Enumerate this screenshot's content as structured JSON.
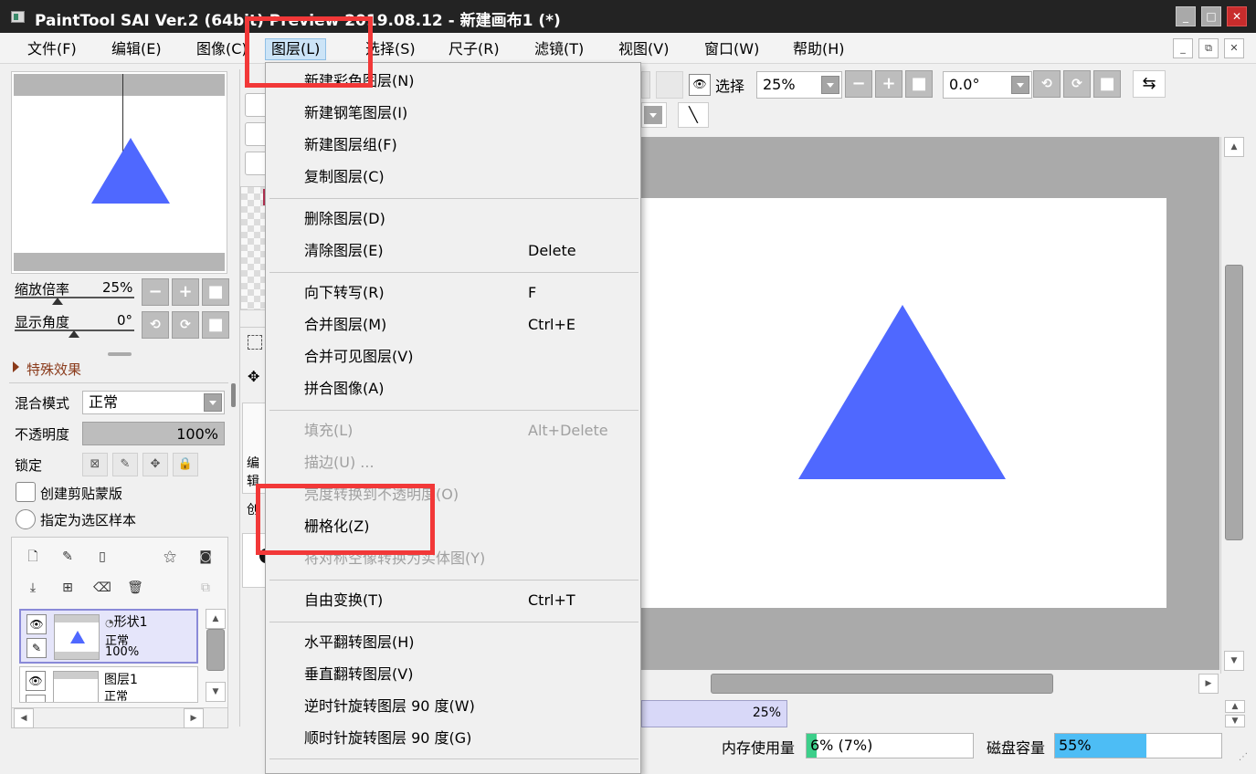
{
  "window": {
    "title": "PaintTool SAI Ver.2 (64bit) Preview 2019.08.12 - 新建画布1 (*)",
    "minimize": "_",
    "maximize": "□",
    "close": "✕"
  },
  "menubar": {
    "items": [
      {
        "label": "文件(F)"
      },
      {
        "label": "编辑(E)"
      },
      {
        "label": "图像(C)"
      },
      {
        "label": "图层(L)"
      },
      {
        "label": "选择(S)"
      },
      {
        "label": "尺子(R)"
      },
      {
        "label": "滤镜(T)"
      },
      {
        "label": "视图(V)"
      },
      {
        "label": "窗口(W)"
      },
      {
        "label": "帮助(H)"
      }
    ]
  },
  "left_panel": {
    "zoom_label": "缩放倍率",
    "zoom_value": "25%",
    "angle_label": "显示角度",
    "angle_value": "0°",
    "effects_label": "特殊效果",
    "blend_label": "混合模式",
    "blend_value": "正常",
    "opacity_label": "不透明度",
    "opacity_value": "100%",
    "lock_label": "锁定",
    "clip_label": "创建剪贴蒙版",
    "sample_label": "指定为选区样本",
    "layers": [
      {
        "name": "形状1",
        "mode": "正常",
        "opacity": "100%"
      },
      {
        "name": "图层1",
        "mode": "正常"
      }
    ]
  },
  "middle_panel": {
    "edit_label": "编辑",
    "create_label": "创"
  },
  "toolbar": {
    "select_label": "选择",
    "zoom_value": "25%",
    "angle_value": "0.0°"
  },
  "dropdown": {
    "groups": [
      [
        {
          "label": "新建彩色图层(N)",
          "shortcut": ""
        },
        {
          "label": "新建钢笔图层(I)",
          "shortcut": ""
        },
        {
          "label": "新建图层组(F)",
          "shortcut": ""
        },
        {
          "label": "复制图层(C)",
          "shortcut": ""
        }
      ],
      [
        {
          "label": "删除图层(D)",
          "shortcut": ""
        },
        {
          "label": "清除图层(E)",
          "shortcut": "Delete"
        }
      ],
      [
        {
          "label": "向下转写(R)",
          "shortcut": "F"
        },
        {
          "label": "合并图层(M)",
          "shortcut": "Ctrl+E"
        },
        {
          "label": "合并可见图层(V)",
          "shortcut": ""
        },
        {
          "label": "拼合图像(A)",
          "shortcut": ""
        }
      ],
      [
        {
          "label": "填充(L)",
          "shortcut": "Alt+Delete",
          "disabled": true
        },
        {
          "label": "描边(U) ...",
          "shortcut": "",
          "disabled": true
        },
        {
          "label": "亮度转换到不透明度(O)",
          "shortcut": "",
          "disabled": true
        },
        {
          "label": "栅格化(Z)",
          "shortcut": ""
        },
        {
          "label": "将对称空像转换为实体图(Y)",
          "shortcut": "",
          "disabled": true
        }
      ],
      [
        {
          "label": "自由变换(T)",
          "shortcut": "Ctrl+T"
        }
      ],
      [
        {
          "label": "水平翻转图层(H)",
          "shortcut": ""
        },
        {
          "label": "垂直翻转图层(V)",
          "shortcut": ""
        },
        {
          "label": "逆时针旋转图层 90 度(W)",
          "shortcut": ""
        },
        {
          "label": "顺时针旋转图层 90 度(G)",
          "shortcut": ""
        }
      ]
    ]
  },
  "statusbar": {
    "zoom_value": "25%",
    "memory_label": "内存使用量",
    "memory_value": "6% (7%)",
    "memory_fraction": 0.06,
    "disk_label": "磁盘容量",
    "disk_value": "55%",
    "disk_fraction": 0.55
  },
  "colors": {
    "triangle": "#4f68ff",
    "highlight": "#f23838",
    "titlebar": "#232323",
    "memory_fill": "#3ccf8a",
    "disk_fill": "#4dbdf5"
  }
}
